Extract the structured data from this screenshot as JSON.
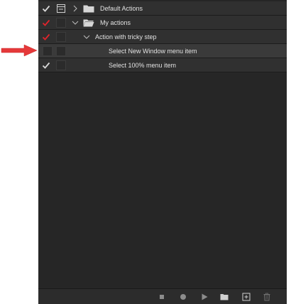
{
  "actions_list": {
    "rows": [
      {
        "label": "Default Actions",
        "checked": true,
        "check_color": "#d8d8d8"
      },
      {
        "label": "My actions",
        "checked": true,
        "check_color": "#e0242b"
      },
      {
        "label": "Action with tricky step",
        "checked": true,
        "check_color": "#e0242b"
      },
      {
        "label": "Select New Window menu item",
        "checked": false
      },
      {
        "label": "Select 100% menu item",
        "checked": true,
        "check_color": "#d8d8d8"
      }
    ]
  },
  "colors": {
    "panel_bg": "#262626",
    "row_bg": "#303030",
    "text": "#e2e2e2",
    "red_check": "#e0242b",
    "annotation_arrow": "#e5393a"
  },
  "icons": {
    "check": "check-icon",
    "dialog_toggle": "dialog-toggle-icon",
    "expand": "chevron-right-icon",
    "collapse": "chevron-down-icon",
    "folder": "folder-icon",
    "stop": "stop-icon",
    "record": "record-icon",
    "play": "play-icon",
    "new_set": "folder-icon",
    "new_action": "new-action-icon",
    "delete": "trash-icon"
  }
}
